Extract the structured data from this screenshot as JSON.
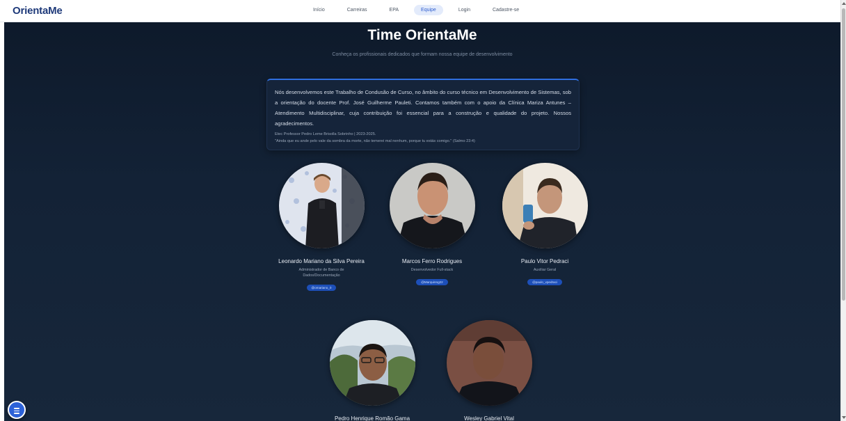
{
  "brand": "OrientaMe",
  "nav": {
    "items": [
      {
        "label": "Início",
        "active": false
      },
      {
        "label": "Carreiras",
        "active": false
      },
      {
        "label": "EPA",
        "active": false
      },
      {
        "label": "Equipe",
        "active": true
      },
      {
        "label": "Login",
        "active": false
      },
      {
        "label": "Cadastre-se",
        "active": false
      }
    ]
  },
  "page": {
    "title": "Time OrientaMe",
    "subtitle": "Conheça os profissionais dedicados que formam nossa equipe de desenvolvimento"
  },
  "intro": {
    "text": "Nós desenvolvemos este Trabalho de Condusão de Curso, no âmbito do curso técnico em Desenvolvimento de Sistemas, sob a orientação do docente Prof. José Guilherme Pauleti. Contamos também com o apoio da Clínica Mariza Antunes – Atendimento Multidisciplinar, cuja contribuição foi essencial para a construção e qualidade do projeto. Nossos agradecimentos.",
    "school": "Etec Professor Pedro Leme Brisolla Sobrinho | 2023-2025.",
    "quote": "\"Ainda que eu ande pelo vale da sombra da morte, não temerei mal nenhum, porque tu estás comigo.\" (Salmo 23:4)"
  },
  "members": [
    {
      "name": "Leonardo Mariano da Silva Pereira",
      "role": "Administrador de Banco de Dados/Documentação",
      "handle": "@omariano_0"
    },
    {
      "name": "Marcos Ferro Rodrigues",
      "role": "Desenvolvedor Full-stack",
      "handle": "@Marquinng22"
    },
    {
      "name": "Paulo Vitor Pedraci",
      "role": "Auxiliar Geral",
      "handle": "@paulo_vpedraci"
    },
    {
      "name": "Pedro Henrique Romão Gama",
      "role": "",
      "handle": ""
    },
    {
      "name": "Wesley Gabriel Vital",
      "role": "",
      "handle": ""
    }
  ],
  "colors": {
    "brand": "#1f3a7a",
    "accent": "#2f5ecf",
    "background": "#132236",
    "badge": "#1d4fb8"
  },
  "icons": {
    "menu_fab": "menu-icon"
  }
}
